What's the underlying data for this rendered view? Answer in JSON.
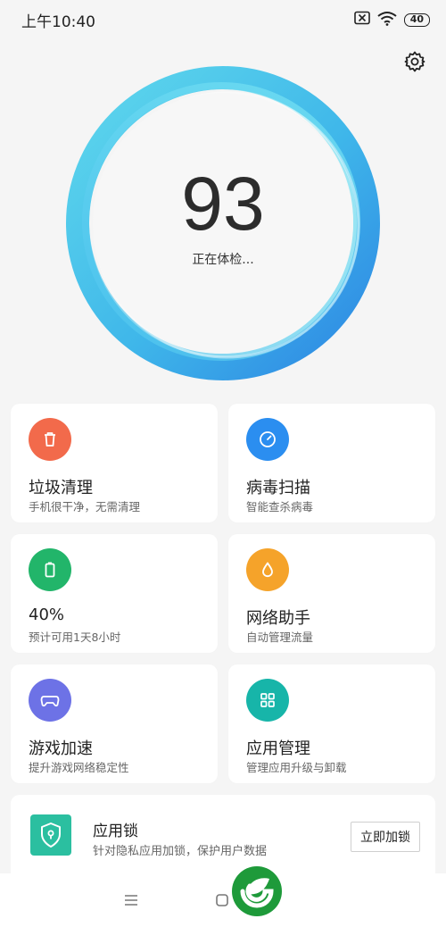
{
  "status_bar": {
    "time": "上午10:40",
    "battery": "40"
  },
  "checkup": {
    "score": "93",
    "status": "正在体检..."
  },
  "cards": [
    {
      "title": "垃圾清理",
      "subtitle": "手机很干净，无需清理",
      "color": "#f26a4b"
    },
    {
      "title": "病毒扫描",
      "subtitle": "智能查杀病毒",
      "color": "#2b8ef0"
    },
    {
      "title": "40%",
      "subtitle": "预计可用1天8小时",
      "color": "#22b56a"
    },
    {
      "title": "网络助手",
      "subtitle": "自动管理流量",
      "color": "#f5a32a"
    },
    {
      "title": "游戏加速",
      "subtitle": "提升游戏网络稳定性",
      "color": "#6d72e6"
    },
    {
      "title": "应用管理",
      "subtitle": "管理应用升级与卸载",
      "color": "#17b5a9"
    }
  ],
  "app_lock": {
    "title": "应用锁",
    "subtitle": "针对隐私应用加锁，保护用户数据",
    "button": "立即加锁",
    "color": "#2bbfa0"
  },
  "colors": {
    "accent": "#3ab4e8",
    "background": "#f5f5f5"
  }
}
